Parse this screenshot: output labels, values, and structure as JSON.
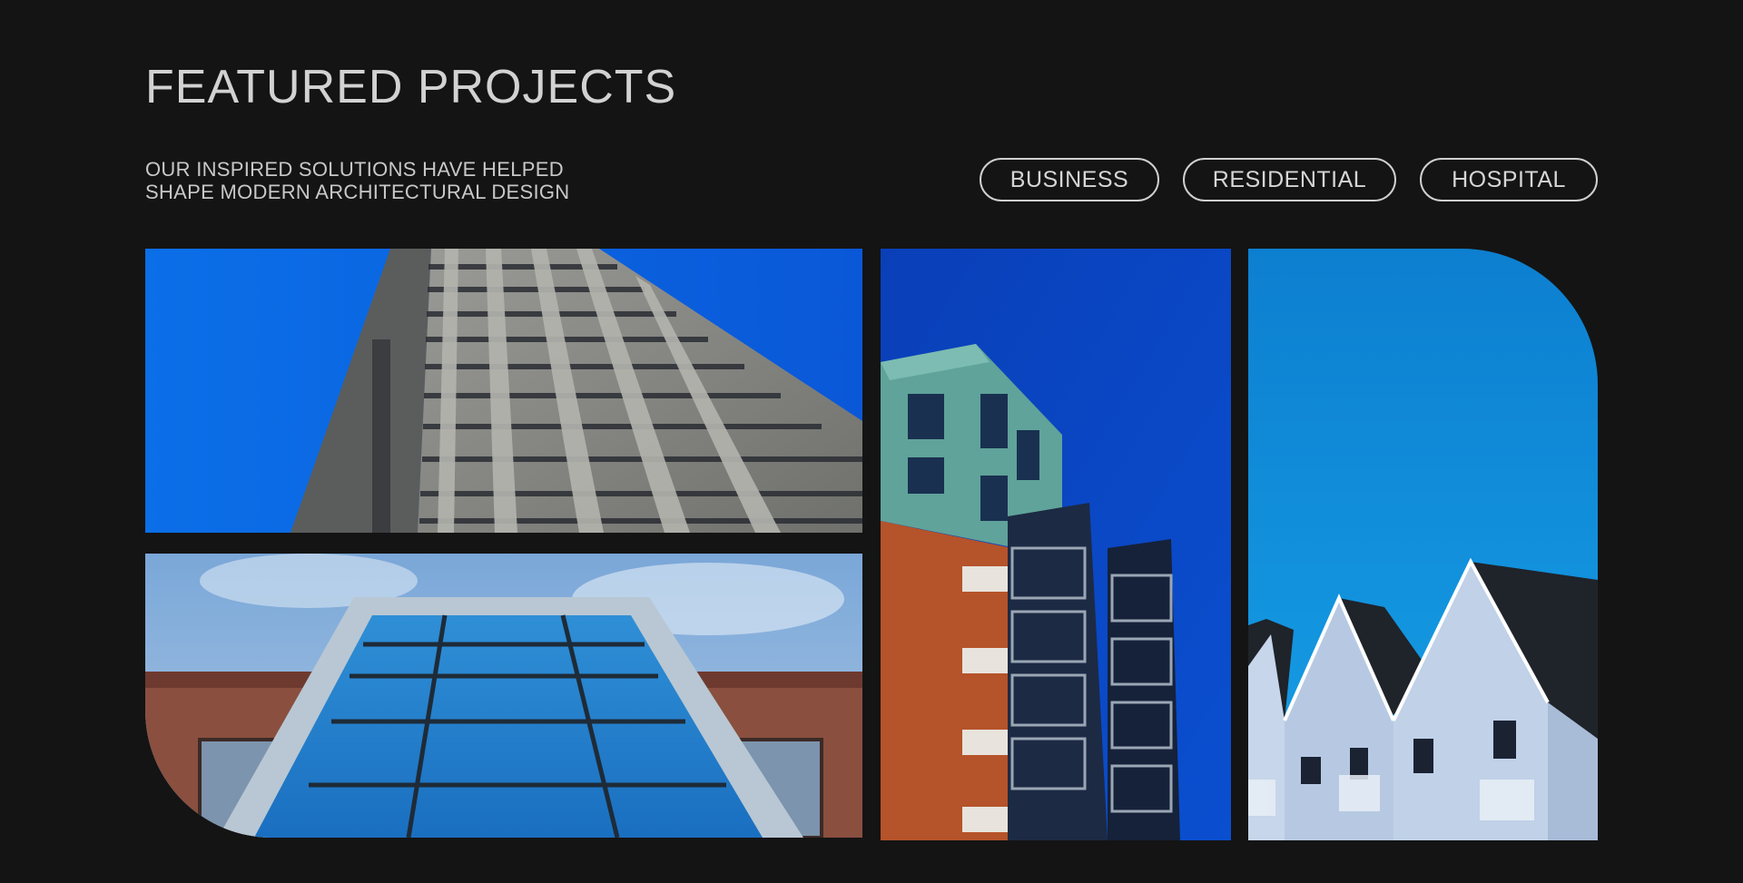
{
  "header": {
    "title": "FEATURED PROJECTS",
    "subtitle_line1": "OUR INSPIRED SOLUTIONS HAVE HELPED",
    "subtitle_line2": "SHAPE MODERN ARCHITECTURAL DESIGN"
  },
  "filters": [
    {
      "label": "BUSINESS"
    },
    {
      "label": "RESIDENTIAL"
    },
    {
      "label": "HOSPITAL"
    }
  ],
  "colors": {
    "background": "#141414",
    "text": "#d2d2d2",
    "sky_blue": "#0a5fe0",
    "brick": "#b5532a"
  },
  "gallery": [
    {
      "subject": "concrete high-rise tower against blue sky"
    },
    {
      "subject": "glass stairwell facade with brick walls"
    },
    {
      "subject": "teal and brick apartment tower with glass balconies"
    },
    {
      "subject": "gabled white houses with dark roofs"
    }
  ]
}
